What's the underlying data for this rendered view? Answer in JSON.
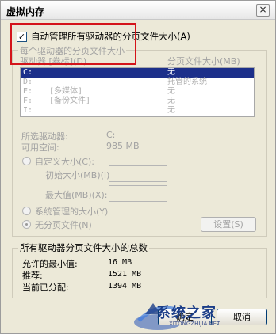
{
  "window": {
    "title": "虚拟内存",
    "close_glyph": "×"
  },
  "auto_manage": {
    "label": "自动管理所有驱动器的分页文件大小(A)",
    "checked": true,
    "check_glyph": "✓"
  },
  "drive_group": {
    "title": "每个驱动器的分页文件大小",
    "columns": {
      "drive": "驱动器 [卷标](D)",
      "size": "分页文件大小(MB)"
    },
    "rows": [
      {
        "drive": "C:",
        "label": "",
        "size": "无",
        "selected": true
      },
      {
        "drive": "D:",
        "label": "",
        "size": "托管的系统",
        "selected": false
      },
      {
        "drive": "E:",
        "label": "[多媒体]",
        "size": "无",
        "selected": false
      },
      {
        "drive": "F:",
        "label": "[备份文件]",
        "size": "无",
        "selected": false
      },
      {
        "drive": "I:",
        "label": "",
        "size": "无",
        "selected": false
      }
    ],
    "selected_drive_label": "所选驱动器:",
    "selected_drive_value": "C:",
    "free_space_label": "可用空间:",
    "free_space_value": "985 MB",
    "custom_size_label": "自定义大小(C):",
    "initial_size_label": "初始大小(MB)(I):",
    "initial_size_value": "",
    "max_size_label": "最大值(MB)(X):",
    "max_size_value": "",
    "system_managed_label": "系统管理的大小(Y)",
    "no_paging_label": "无分页文件(N)",
    "set_button": "设置(S)"
  },
  "total_group": {
    "title": "所有驱动器分页文件大小的总数",
    "min_label": "允许的最小值:",
    "min_value": "16 MB",
    "recommended_label": "推荐:",
    "recommended_value": "1521 MB",
    "current_label": "当前已分配:",
    "current_value": "1394 MB"
  },
  "buttons": {
    "ok": "确定",
    "cancel": "取消"
  },
  "watermark": {
    "text": "系统之家",
    "sub": "XITONGZHIJIA.NET"
  },
  "colors": {
    "highlight": "#d4141a",
    "selection": "#1c2f8a",
    "watermark": "#1b3d88"
  }
}
